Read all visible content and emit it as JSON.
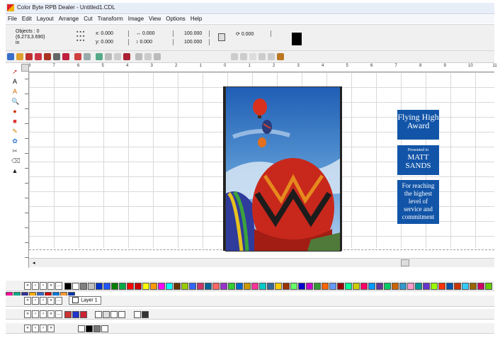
{
  "window": {
    "title": "Color Byte RPB Dealer - Untitled1.CDL"
  },
  "menu": [
    "File",
    "Edit",
    "Layout",
    "Arrange",
    "Cut",
    "Transform",
    "Image",
    "View",
    "Options",
    "Help"
  ],
  "properties": {
    "objects_label": "Objects : 0",
    "coords": "(6.273,3.690)",
    "units": "in",
    "x_label": "x:",
    "x_value": "0.000",
    "y_label": "y:",
    "y_value": "0.000",
    "w_value": "0.000",
    "h_value": "0.000",
    "scale_x": "100.000",
    "scale_y": "100.000",
    "rotation": "0.000"
  },
  "ruler": {
    "h_labels": [
      "8",
      "7",
      "6",
      "5",
      "4",
      "3",
      "2",
      "1",
      "0",
      "1",
      "2",
      "3",
      "4",
      "5",
      "6",
      "7",
      "8",
      "9",
      "10",
      "11"
    ]
  },
  "award": {
    "title": "Flying High Award",
    "presented_to": "Presented to",
    "name": "MATT SANDS",
    "reason": "For reaching the highest level of service and commitment"
  },
  "layers": {
    "current": "Layer 1"
  },
  "palette": [
    "#000000",
    "#ffffff",
    "#808080",
    "#c0c0c0",
    "#0033cc",
    "#2255ff",
    "#008000",
    "#00aa44",
    "#ff0000",
    "#cc0000",
    "#ffff00",
    "#ff9900",
    "#ff00ff",
    "#00ffff",
    "#663300",
    "#99cc00",
    "#3366ff",
    "#cc3366",
    "#006699",
    "#ff6666",
    "#9933cc",
    "#33cc33",
    "#0066cc",
    "#cc9900",
    "#ff3399",
    "#00cccc",
    "#336699",
    "#ffcc00",
    "#993300",
    "#66ff66",
    "#0000cc",
    "#cc00cc",
    "#339933",
    "#ff6600",
    "#6699ff",
    "#990000",
    "#00ff99",
    "#cccc00",
    "#ff0066",
    "#0099ff",
    "#663399",
    "#00cc66",
    "#cc6600",
    "#3399cc",
    "#ff99cc",
    "#009999",
    "#6633cc",
    "#99ff00",
    "#ff3300",
    "#0055aa",
    "#cc3300",
    "#33ccff",
    "#996600",
    "#cc0066",
    "#66cc00",
    "#ff0099",
    "#00aa88",
    "#333399",
    "#ffaa00",
    "#3366cc",
    "#cc0000",
    "#0077dd",
    "#ff9933",
    "#0033aa"
  ]
}
